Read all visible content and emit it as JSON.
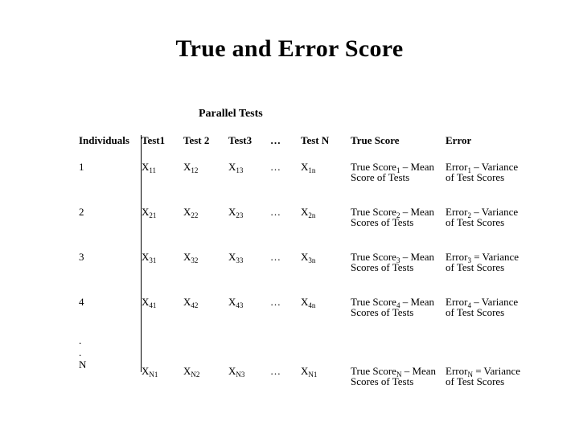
{
  "slide": {
    "title": "True and Error Score",
    "parallel_tests_label": "Parallel Tests",
    "table": {
      "headers": [
        "Individuals",
        "Test1",
        "Test 2",
        "Test3",
        "…",
        "Test N",
        "True Score",
        "Error"
      ],
      "rows": [
        {
          "individual": "1",
          "t1": "X",
          "t1_sub": "11",
          "t2": "X",
          "t2_sub": "12",
          "t3": "X",
          "t3_sub": "13",
          "dots": "…",
          "tn": "X",
          "tn_sub": "1n",
          "true_score": "True Score",
          "true_sub": "1",
          "true_rest": " – Mean Score of Tests",
          "error": "Error",
          "error_sub": "1",
          "error_rest": " – Variance of Test Scores"
        },
        {
          "individual": "2",
          "t1": "X",
          "t1_sub": "21",
          "t2": "X",
          "t2_sub": "22",
          "t3": "X",
          "t3_sub": "23",
          "dots": "…",
          "tn": "X",
          "tn_sub": "2n",
          "true_score": "True Score",
          "true_sub": "2",
          "true_rest": " – Mean Scores of Tests",
          "error": "Error",
          "error_sub": "2",
          "error_rest": " – Variance of Test Scores"
        },
        {
          "individual": "3",
          "t1": "X",
          "t1_sub": "31",
          "t2": "X",
          "t2_sub": "32",
          "t3": "X",
          "t3_sub": "33",
          "dots": "…",
          "tn": "X",
          "tn_sub": "3n",
          "true_score": "True Score",
          "true_sub": "3",
          "true_rest": " – Mean Scores of Tests",
          "error": "Error",
          "error_sub": "3",
          "error_rest": " = Variance of Test Scores"
        },
        {
          "individual": "4",
          "t1": "X",
          "t1_sub": "41",
          "t2": "X",
          "t2_sub": "42",
          "t3": "X",
          "t3_sub": "43",
          "dots": "…",
          "tn": "X",
          "tn_sub": "4n",
          "true_score": "True Score",
          "true_sub": "4",
          "true_rest": " – Mean Scores of Tests",
          "error": "Error",
          "error_sub": "4",
          "error_rest": " – Variance of Test Scores"
        },
        {
          "individual": ".\n.\nN",
          "individual_line1": ".",
          "individual_line2": ".",
          "individual_line3": "N",
          "t1": "X",
          "t1_sub": "N1",
          "t2": "X",
          "t2_sub": "N2",
          "t3": "X",
          "t3_sub": "N3",
          "dots": "…",
          "tn": "X",
          "tn_sub": "N1",
          "true_score": "True Score",
          "true_sub": "N",
          "true_rest": " – Mean Scores of Tests",
          "error": "Error",
          "error_sub": "N",
          "error_rest": " = Variance of Test Scores"
        }
      ]
    }
  }
}
